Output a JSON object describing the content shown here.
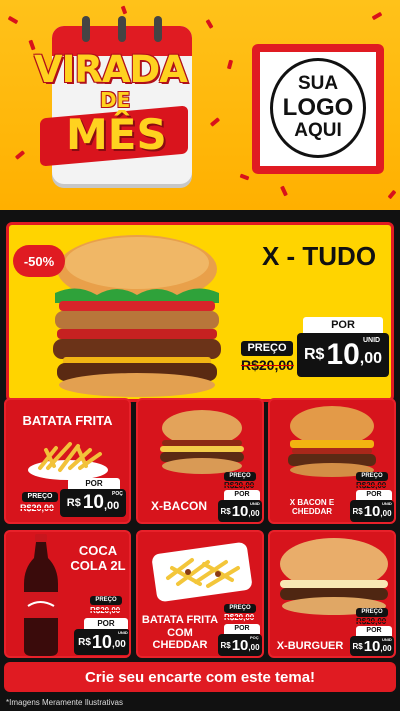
{
  "header": {
    "title_line1": "VIRADA",
    "title_line2": "DE",
    "title_line3": "MÊS",
    "logo_line1": "SUA",
    "logo_line2": "LOGO",
    "logo_line3": "AQUI"
  },
  "hero": {
    "discount": "-50%",
    "name": "X - TUDO",
    "preco_label": "PREÇO",
    "old_price": "R$20,00",
    "por_label": "POR",
    "new_price_currency": "R$",
    "new_price_int": "10",
    "new_price_cents": ",00",
    "unid": "UNID"
  },
  "products": [
    {
      "name": "BATATA FRITA",
      "preco_label": "PREÇO",
      "old_price": "R$20,00",
      "por_label": "POR",
      "currency": "R$",
      "int": "10",
      "cents": ",00",
      "unid": "POÇ"
    },
    {
      "name": "X-BACON",
      "preco_label": "PREÇO",
      "old_price": "R$20,00",
      "por_label": "POR",
      "currency": "R$",
      "int": "10",
      "cents": ",00",
      "unid": "UNID"
    },
    {
      "name": "X BACON E CHEDDAR",
      "preco_label": "PREÇO",
      "old_price": "R$20,00",
      "por_label": "POR",
      "currency": "R$",
      "int": "10",
      "cents": ",00",
      "unid": "UNID"
    },
    {
      "name": "COCA COLA 2L",
      "preco_label": "PREÇO",
      "old_price": "R$20,00",
      "por_label": "POR",
      "currency": "R$",
      "int": "10",
      "cents": ",00",
      "unid": "UNID"
    },
    {
      "name": "BATATA FRITA COM CHEDDAR",
      "preco_label": "PREÇO",
      "old_price": "R$20,00",
      "por_label": "POR",
      "currency": "R$",
      "int": "10",
      "cents": ",00",
      "unid": "POÇ"
    },
    {
      "name": "X-BURGUER",
      "preco_label": "PREÇO",
      "old_price": "R$20,00",
      "por_label": "POR",
      "currency": "R$",
      "int": "10",
      "cents": ",00",
      "unid": "UNID"
    }
  ],
  "cta": "Crie seu encarte com este tema!",
  "footnote": "*Imagens Meramente Ilustrativas",
  "colors": {
    "red": "#e01b22",
    "yellow": "#ffd400",
    "black": "#111111"
  }
}
